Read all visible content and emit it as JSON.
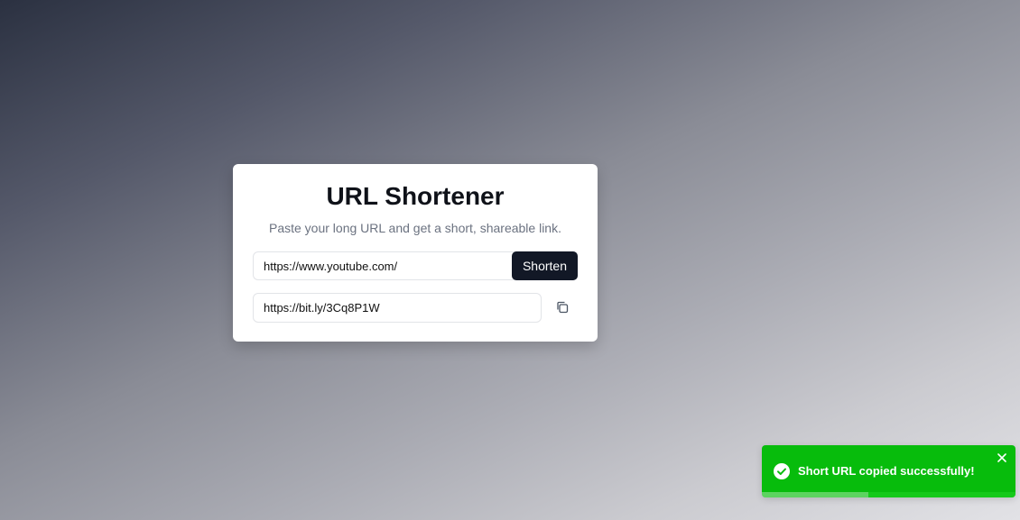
{
  "card": {
    "title": "URL Shortener",
    "subtitle": "Paste your long URL and get a short, shareable link."
  },
  "form": {
    "long_url_value": "https://www.youtube.com/",
    "shorten_label": "Shorten",
    "short_url_value": "https://bit.ly/3Cq8P1W"
  },
  "icons": {
    "copy": "copy-icon",
    "toast_status": "check-circle-icon",
    "toast_close": "close-icon"
  },
  "toast": {
    "message": "Short URL copied successfully!",
    "color": "#07bc0c",
    "progress_remaining": 0.58
  },
  "colors": {
    "button": "#121826",
    "title": "#0f1219",
    "subtitle": "#6b7280"
  }
}
